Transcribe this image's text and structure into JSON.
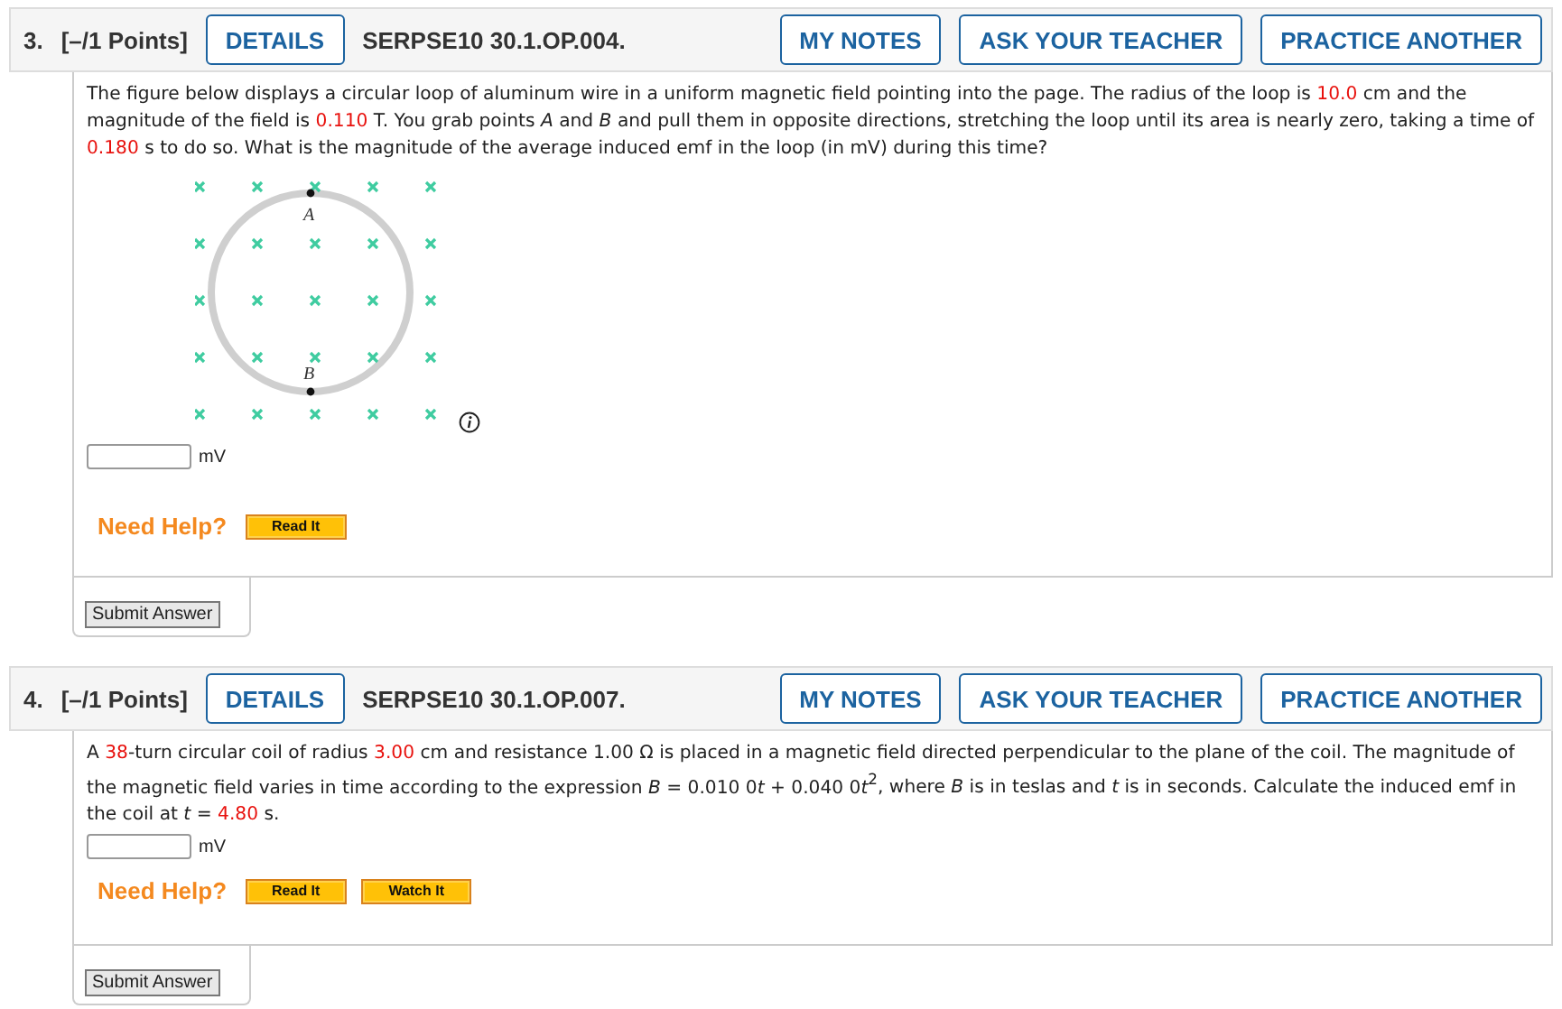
{
  "questions": [
    {
      "number": "3.",
      "points": "[–/1 Points]",
      "details": "DETAILS",
      "code": "SERPSE10 30.1.OP.004.",
      "actions": [
        "MY NOTES",
        "ASK YOUR TEACHER",
        "PRACTICE ANOTHER"
      ],
      "statement": [
        {
          "kind": "plain",
          "text": "The figure below displays a circular loop of aluminum wire in a uniform magnetic field pointing into the page. The radius of the loop is "
        },
        {
          "kind": "value",
          "text": "10.0"
        },
        {
          "kind": "plain",
          "text": " cm and the magnitude of the field is "
        },
        {
          "kind": "value",
          "text": "0.110"
        },
        {
          "kind": "plain",
          "text": " T. You grab points *A* and *B* and pull them in opposite directions, stretching the loop until its area is nearly zero, taking a time of "
        },
        {
          "kind": "value",
          "text": "0.180"
        },
        {
          "kind": "plain",
          "text": " s to do so. What is the magnitude of the average induced emf in the loop (in mV) during this time?"
        }
      ],
      "figure": {
        "kind": "loop",
        "point_labels": [
          "A",
          "B"
        ]
      },
      "unit": "mV",
      "help_label": "Need Help?",
      "help_buttons": [
        "Read It"
      ],
      "submit": "Submit Answer"
    },
    {
      "number": "4.",
      "points": "[–/1 Points]",
      "details": "DETAILS",
      "code": "SERPSE10 30.1.OP.007.",
      "actions": [
        "MY NOTES",
        "ASK YOUR TEACHER",
        "PRACTICE ANOTHER"
      ],
      "statement": [
        {
          "kind": "plain",
          "text": "A "
        },
        {
          "kind": "value",
          "text": "38"
        },
        {
          "kind": "plain",
          "text": "-turn circular coil of radius "
        },
        {
          "kind": "value",
          "text": "3.00"
        },
        {
          "kind": "plain",
          "text": " cm and resistance 1.00 Ω is placed in a magnetic field directed perpendicular to the plane of the coil. The magnitude of the magnetic field varies in time according to the expression *B* = 0.010 0"
        },
        {
          "kind": "variable",
          "text": "t"
        },
        {
          "kind": "plain",
          "text": " + 0.040 0"
        },
        {
          "kind": "variable",
          "text": "t"
        },
        {
          "kind": "plain",
          "text": "$^{2}$, where *B* is in teslas and *t* is in seconds. Calculate the induced emf in the coil at *t* = "
        },
        {
          "kind": "value",
          "text": "4.80"
        },
        {
          "kind": "plain",
          "text": " s."
        }
      ],
      "unit": "mV",
      "help_label": "Need Help?",
      "help_buttons": [
        "Read It",
        "Watch It"
      ],
      "submit": "Submit Answer"
    }
  ]
}
